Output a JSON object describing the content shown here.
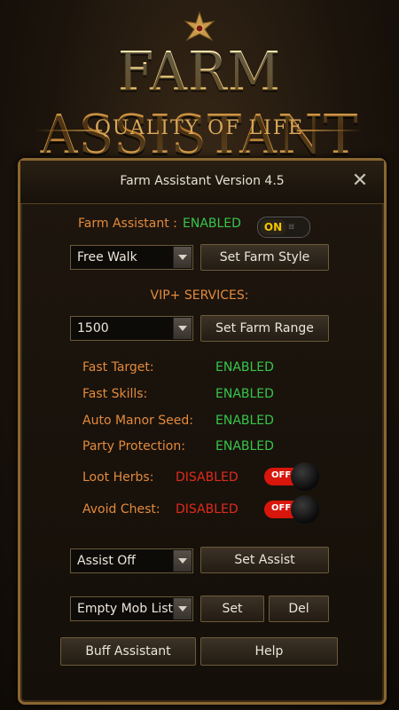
{
  "banner": {
    "title": "FARM ASSISTANT",
    "subtitle": "QUALITY OF LIFE"
  },
  "panel": {
    "title": "Farm Assistant Version 4.5",
    "close_label": "✕",
    "status_label": "Farm Assistant :",
    "status_value": "ENABLED",
    "main_toggle": "ON",
    "farm_style_select": "Free Walk",
    "farm_style_button": "Set Farm Style",
    "vip_heading": "VIP+ SERVICES:",
    "farm_range_select": "1500",
    "farm_range_button": "Set Farm Range",
    "services": [
      {
        "label": "Fast Target:",
        "value": "ENABLED"
      },
      {
        "label": "Fast Skills:",
        "value": "ENABLED"
      },
      {
        "label": "Auto Manor Seed:",
        "value": "ENABLED"
      },
      {
        "label": "Party Protection:",
        "value": "ENABLED"
      },
      {
        "label": "Loot Herbs:",
        "value": "DISABLED",
        "toggle": "OFF"
      },
      {
        "label": "Avoid Chest:",
        "value": "DISABLED",
        "toggle": "OFF"
      }
    ],
    "assist_select": "Assist Off",
    "assist_button": "Set Assist",
    "mob_list_select": "Empty Mob List",
    "mob_set_button": "Set",
    "mob_del_button": "Del",
    "buff_button": "Buff Assistant",
    "help_button": "Help"
  },
  "colors": {
    "enabled": "#37c64a",
    "disabled": "#e12a1c",
    "label": "#e38a3c",
    "gold": "#e8b85a"
  }
}
